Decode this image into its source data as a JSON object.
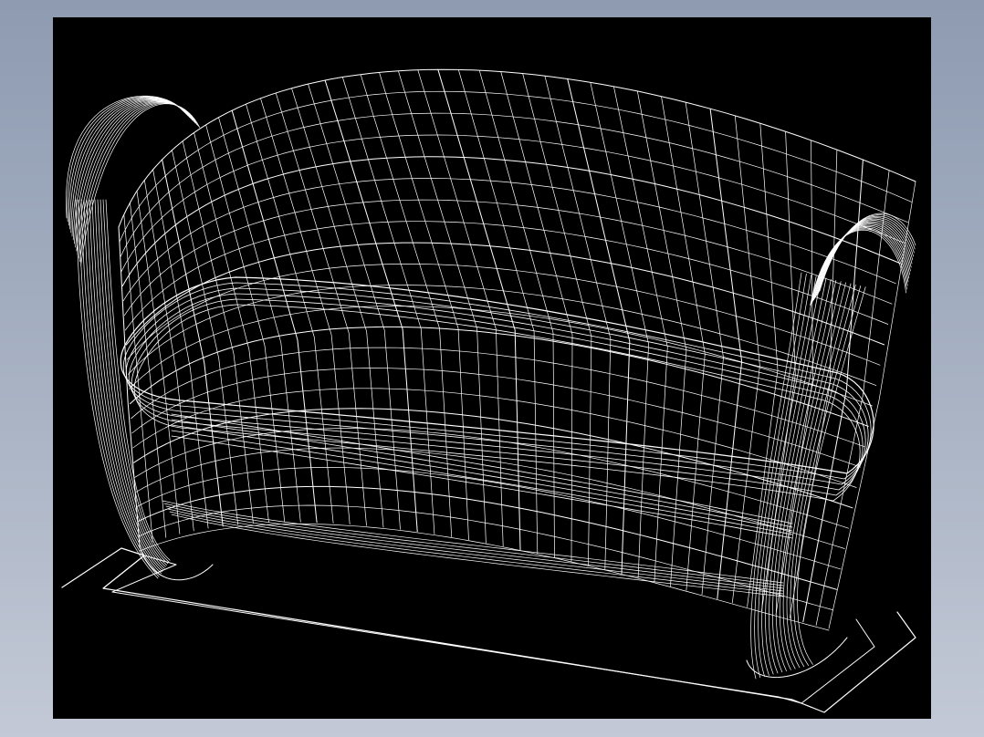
{
  "canvas": {
    "background_color": "#000000",
    "line_color": "#ffffff",
    "frame_gradient_top": "#8e9bb1",
    "frame_gradient_bottom": "#c3c9d6"
  },
  "drawing": {
    "subject": "sofa-wireframe",
    "view": "isometric"
  }
}
